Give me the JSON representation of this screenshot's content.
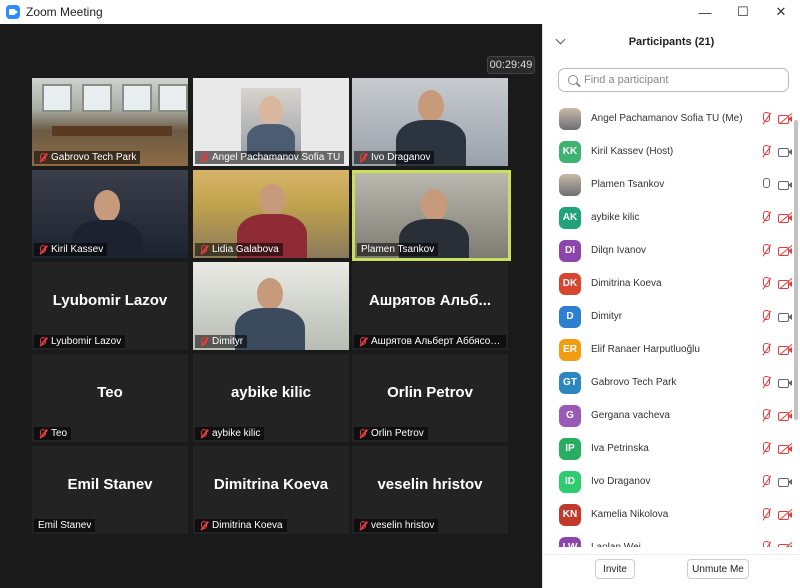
{
  "window": {
    "title": "Zoom Meeting",
    "controls": [
      "—",
      "☐",
      "✕"
    ]
  },
  "meeting": {
    "timer": "00:29:49"
  },
  "tiles": [
    {
      "name": "Gabrovo Tech Park",
      "muted": true,
      "video": "room"
    },
    {
      "name": "Angel Pachamanov  Sofia TU",
      "muted": true,
      "video": "portrait"
    },
    {
      "name": "Ivo Draganov",
      "muted": true,
      "video": "ivo"
    },
    {
      "name": "Kiril Kassev",
      "muted": true,
      "video": "kiril"
    },
    {
      "name": "Lidia Galabova",
      "muted": true,
      "video": "lidia"
    },
    {
      "name": "Plamen Tsankov",
      "muted": false,
      "video": "plamen",
      "active": true
    },
    {
      "name": "Lyubomir Lazov",
      "muted": true,
      "big": "Lyubomir Lazov"
    },
    {
      "name": "Dimityr",
      "muted": true,
      "video": "dimityr"
    },
    {
      "name": "Ашрятов Альберт Аббясов...",
      "muted": true,
      "big": "Ашрятов Альб..."
    },
    {
      "name": "Teo",
      "muted": true,
      "big": "Teo"
    },
    {
      "name": "aybike kilic",
      "muted": true,
      "big": "aybike kilic"
    },
    {
      "name": "Orlin Petrov",
      "muted": true,
      "big": "Orlin Petrov"
    },
    {
      "name": "Emil Stanev",
      "muted": false,
      "big": "Emil Stanev"
    },
    {
      "name": "Dimitrina Koeva",
      "muted": true,
      "big": "Dimitrina Koeva"
    },
    {
      "name": "veselin hristov",
      "muted": true,
      "big": "veselin hristov"
    }
  ],
  "panel": {
    "title": "Participants (21)",
    "search_placeholder": "Find a participant",
    "participants": [
      {
        "initials": "",
        "photo": true,
        "name": "Angel Pachamanov  Sofia TU (Me)",
        "color": "#888888",
        "mic": "off",
        "cam": "off"
      },
      {
        "initials": "KK",
        "name": "Kiril Kassev (Host)",
        "color": "#3cb371",
        "mic": "off",
        "cam": "on"
      },
      {
        "initials": "",
        "photo": true,
        "name": "Plamen Tsankov",
        "color": "#888888",
        "mic": "on",
        "cam": "on"
      },
      {
        "initials": "AK",
        "name": "aybike kilic",
        "color": "#20a37a",
        "mic": "off",
        "cam": "off"
      },
      {
        "initials": "DI",
        "name": "Dilqn Ivanov",
        "color": "#8e44ad",
        "mic": "off",
        "cam": "off"
      },
      {
        "initials": "DK",
        "name": "Dimitrina Koeva",
        "color": "#d9452f",
        "mic": "off",
        "cam": "off"
      },
      {
        "initials": "D",
        "name": "Dimityr",
        "color": "#2d7fd1",
        "mic": "off",
        "cam": "on"
      },
      {
        "initials": "ER",
        "name": "Elif Ranaer Harputluoğlu",
        "color": "#f39c12",
        "mic": "off",
        "cam": "off"
      },
      {
        "initials": "GT",
        "name": "Gabrovo Tech Park",
        "color": "#2e86c1",
        "mic": "off",
        "cam": "on"
      },
      {
        "initials": "G",
        "name": "Gergana vacheva",
        "color": "#9b59b6",
        "mic": "off",
        "cam": "off"
      },
      {
        "initials": "IP",
        "name": "Iva Petrinska",
        "color": "#27ae60",
        "mic": "off",
        "cam": "off"
      },
      {
        "initials": "ID",
        "name": "Ivo Draganov",
        "color": "#2ecc71",
        "mic": "off",
        "cam": "on"
      },
      {
        "initials": "KN",
        "name": "Kamelia Nikolova",
        "color": "#c0392b",
        "mic": "off",
        "cam": "off"
      },
      {
        "initials": "LW",
        "name": "Laolan Wei",
        "color": "#8e44ad",
        "mic": "off",
        "cam": "off"
      }
    ],
    "invite_label": "Invite",
    "unmute_label": "Unmute Me"
  }
}
